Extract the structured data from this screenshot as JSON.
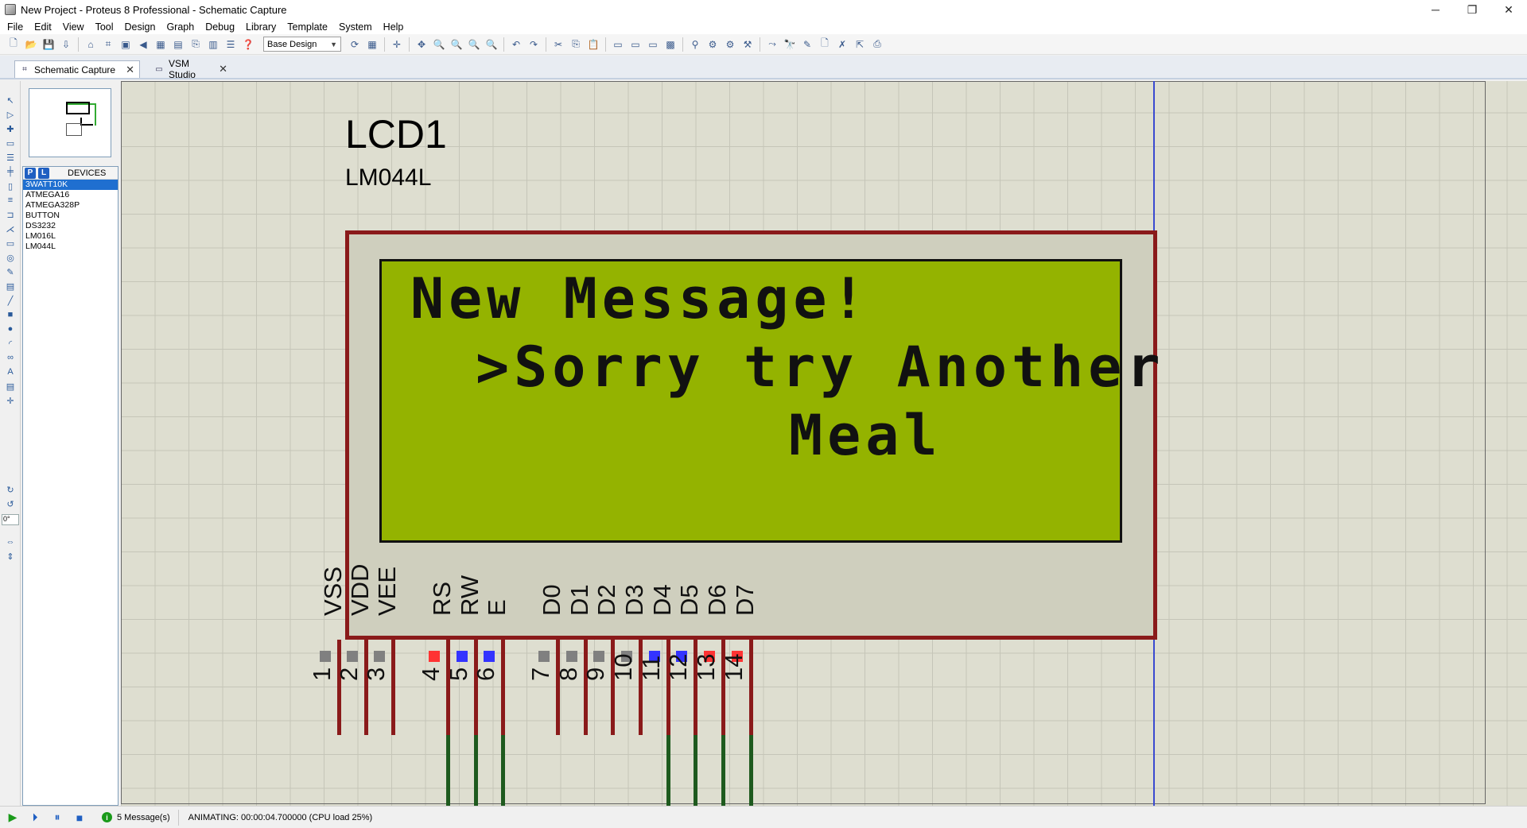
{
  "window": {
    "title": "New Project - Proteus 8 Professional - Schematic Capture",
    "controls": {
      "minimize": "─",
      "restore": "❐",
      "close": "✕"
    }
  },
  "menu": [
    "File",
    "Edit",
    "View",
    "Tool",
    "Design",
    "Graph",
    "Debug",
    "Library",
    "Template",
    "System",
    "Help"
  ],
  "toolbar": {
    "design_select": "Base Design"
  },
  "tabs": [
    {
      "label": "Schematic Capture",
      "active": true
    },
    {
      "label": "VSM Studio",
      "active": false
    }
  ],
  "left_tools": {
    "angle_value": "0°"
  },
  "device_panel": {
    "p_label": "P",
    "l_label": "L",
    "header": "DEVICES",
    "items": [
      "3WATT10K",
      "ATMEGA16",
      "ATMEGA328P",
      "BUTTON",
      "DS3232",
      "LM016L",
      "LM044L"
    ],
    "selected_index": 0
  },
  "schematic": {
    "component_ref": "LCD1",
    "component_model": "LM044L",
    "lcd_lines": [
      "New Message!",
      ">Sorry try Another",
      "Meal"
    ],
    "pin_names": [
      "VSS",
      "VDD",
      "VEE",
      "RS",
      "RW",
      "E",
      "D0",
      "D1",
      "D2",
      "D3",
      "D4",
      "D5",
      "D6",
      "D7"
    ],
    "pin_numbers": [
      "1",
      "2",
      "3",
      "4",
      "5",
      "6",
      "7",
      "8",
      "9",
      "10",
      "11",
      "12",
      "13",
      "14"
    ],
    "pin_states": [
      "grey",
      "grey",
      "grey",
      "red",
      "blue",
      "blue",
      "grey",
      "grey",
      "grey",
      "grey",
      "blue",
      "blue",
      "red",
      "red"
    ],
    "colors": {
      "grey": "#808080",
      "red": "#ff3333",
      "blue": "#3333ff",
      "lcd_bg": "#94b300",
      "frame": "#8a1a1a",
      "wire": "#1e5a1e"
    }
  },
  "status": {
    "messages": "5 Message(s)",
    "animation": "ANIMATING: 00:00:04.700000 (CPU load 25%)"
  }
}
